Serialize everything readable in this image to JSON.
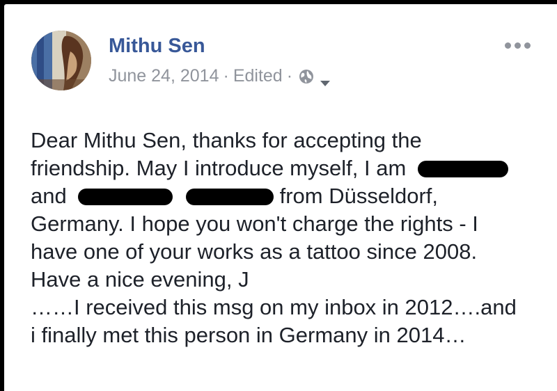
{
  "post": {
    "author_name": "Mithu Sen",
    "date": "June 24, 2014",
    "separator": "·",
    "edited_label": "Edited",
    "privacy_icon": "globe-icon",
    "audience_menu_icon": "caret-down-icon",
    "options_icon": "more-options-icon",
    "lines": {
      "l1": "Dear Mithu Sen, thanks for accepting the",
      "l2_start": "friendship. May I introduce myself, I am",
      "l3_start": "and",
      "l3_end": "from Düsseldorf,",
      "l4": "Germany. I hope you won't charge the rights - I",
      "l5": "have one of your works as a tattoo since 2008.",
      "l6": "Have a nice evening, J",
      "l7": "……I received this msg on my inbox in 2012….and",
      "l8": "i finally met this person in Germany in 2014…"
    }
  },
  "colors": {
    "author": "#385898",
    "meta": "#90949c",
    "text": "#1d2129",
    "redaction": "#000000"
  }
}
